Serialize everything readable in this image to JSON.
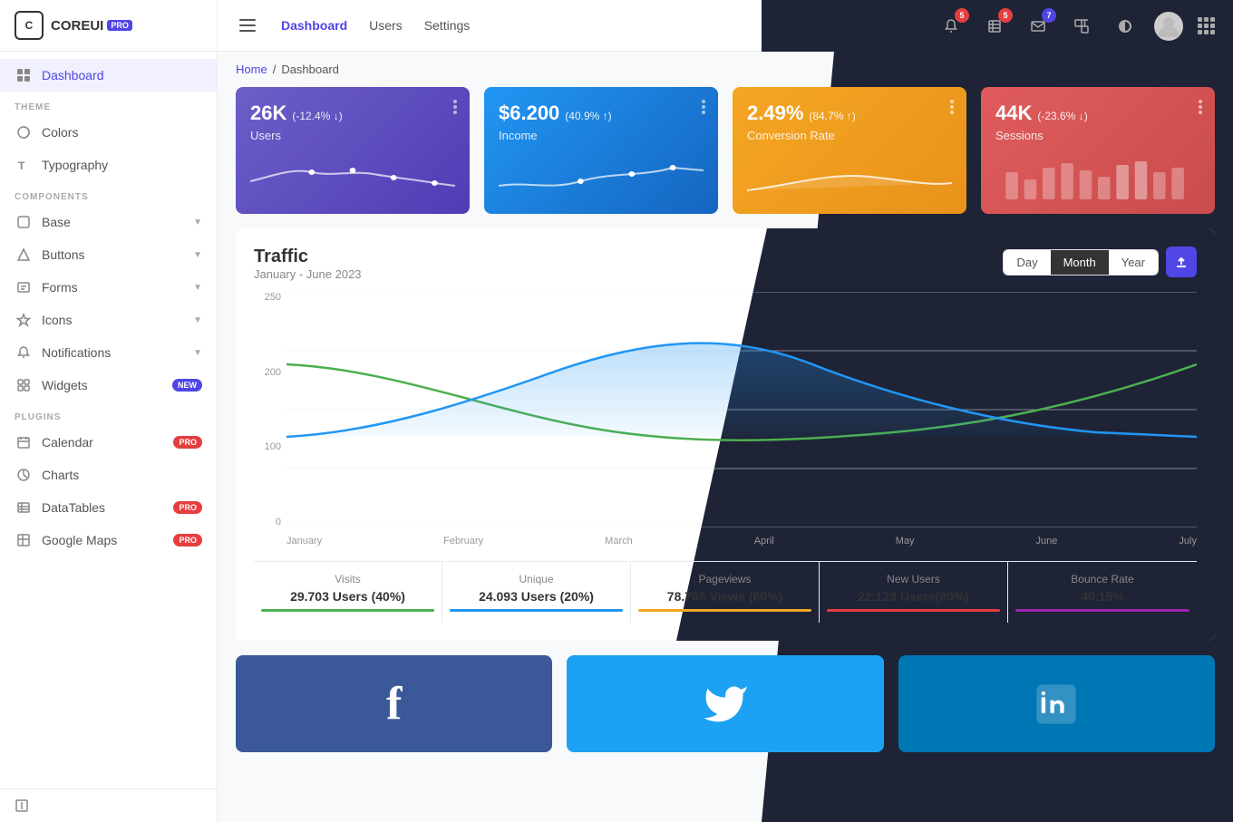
{
  "app": {
    "name": "COREUI",
    "pro_label": "PRO"
  },
  "header": {
    "nav": [
      {
        "label": "Dashboard",
        "active": true
      },
      {
        "label": "Users"
      },
      {
        "label": "Settings"
      }
    ],
    "notifications_count": "5",
    "tasks_count": "5",
    "messages_count": "7"
  },
  "breadcrumb": {
    "home": "Home",
    "separator": "/",
    "current": "Dashboard"
  },
  "sidebar": {
    "items": [
      {
        "label": "Dashboard",
        "section": null
      },
      {
        "label": "Colors",
        "section": "THEME"
      },
      {
        "label": "Typography",
        "section": null
      },
      {
        "label": "Base",
        "section": "COMPONENTS",
        "has_chevron": true
      },
      {
        "label": "Buttons",
        "has_chevron": true
      },
      {
        "label": "Forms",
        "has_chevron": true
      },
      {
        "label": "Icons",
        "has_chevron": true
      },
      {
        "label": "Notifications",
        "has_chevron": true
      },
      {
        "label": "Widgets",
        "badge": "NEW"
      },
      {
        "label": "Calendar",
        "section": "PLUGINS",
        "badge_pro": "PRO"
      },
      {
        "label": "Charts"
      },
      {
        "label": "DataTables",
        "badge_pro": "PRO"
      },
      {
        "label": "Google Maps",
        "badge_pro": "PRO"
      }
    ]
  },
  "stats": [
    {
      "value": "26K",
      "change": "(-12.4% ↓)",
      "label": "Users",
      "color": "purple"
    },
    {
      "value": "$6.200",
      "change": "(40.9% ↑)",
      "label": "Income",
      "color": "blue"
    },
    {
      "value": "2.49%",
      "change": "(84.7% ↑)",
      "label": "Conversion Rate",
      "color": "yellow"
    },
    {
      "value": "44K",
      "change": "(-23.6% ↓)",
      "label": "Sessions",
      "color": "red"
    }
  ],
  "traffic": {
    "title": "Traffic",
    "subtitle": "January - June 2023",
    "controls": [
      "Day",
      "Month",
      "Year"
    ],
    "active_control": "Month",
    "y_labels": [
      "250",
      "200",
      "100",
      "0"
    ],
    "x_labels": [
      "January",
      "February",
      "March",
      "April",
      "May",
      "June",
      "July"
    ],
    "stats_footer": [
      {
        "label": "Visits",
        "value": "29.703 Users (40%)",
        "color": "#4caf50"
      },
      {
        "label": "Unique",
        "value": "24.093 Users (20%)",
        "color": "#2196f3"
      },
      {
        "label": "Pageviews",
        "value": "78.706 Views (60%)",
        "color": "#f5a623"
      },
      {
        "label": "New Users",
        "value": "22.123 Users(80%)",
        "color": "#e53e3e"
      },
      {
        "label": "Bounce Rate",
        "value": "40.15%",
        "color": "#9c27b0"
      }
    ]
  },
  "social": [
    {
      "label": "Facebook",
      "color": "#3b5998",
      "icon": "f"
    },
    {
      "label": "Twitter",
      "color": "#1da1f2",
      "icon": "🐦"
    },
    {
      "label": "LinkedIn",
      "color": "#0077b5",
      "icon": "in"
    }
  ]
}
